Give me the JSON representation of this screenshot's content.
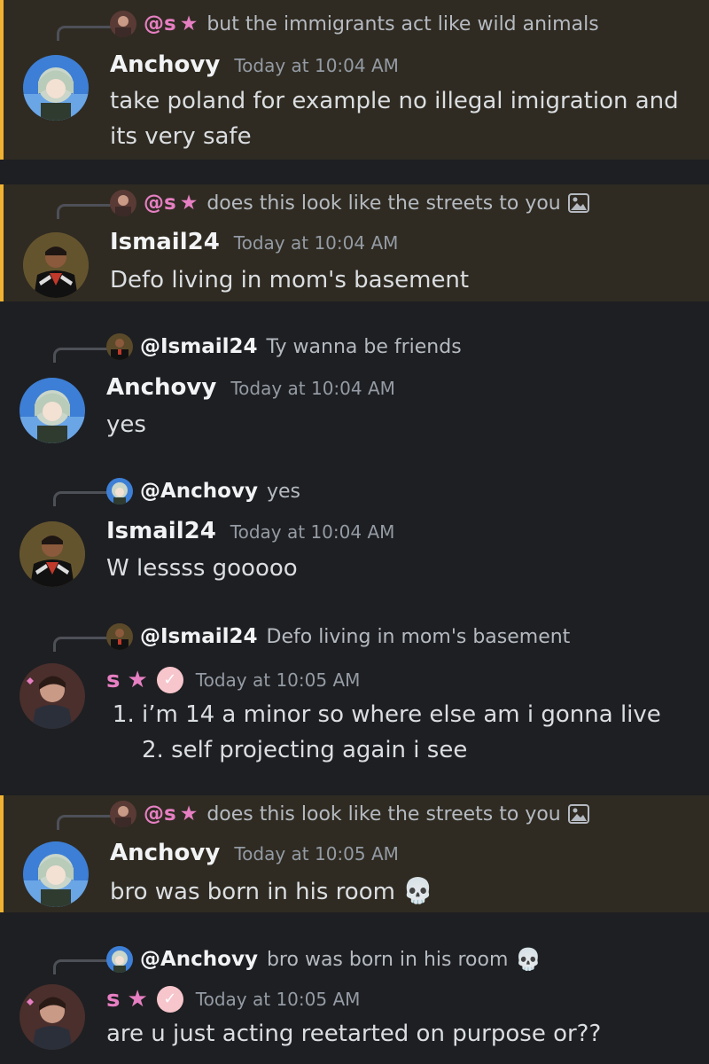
{
  "messages": [
    {
      "reply": {
        "name": "@s",
        "star": "★",
        "text": "but the immigrants act like wild animals"
      },
      "author": "Anchovy",
      "time": "Today at 10:04 AM",
      "content": "take poland for example no illegal imigration and its very safe"
    },
    {
      "reply": {
        "name": "@s",
        "star": "★",
        "text": "does this look like the streets to you"
      },
      "author": "Ismail24",
      "time": "Today at 10:04 AM",
      "content": "Defo living in mom's basement"
    },
    {
      "reply": {
        "name": "@Ismail24",
        "text": "Ty wanna be friends"
      },
      "author": "Anchovy",
      "time": "Today at 10:04 AM",
      "content": "yes"
    },
    {
      "reply": {
        "name": "@Anchovy",
        "text": "yes"
      },
      "author": "Ismail24",
      "time": "Today at 10:04 AM",
      "content": "W lessss gooooo"
    },
    {
      "reply": {
        "name": "@Ismail24",
        "text": "Defo living in mom's basement"
      },
      "author": "s",
      "star": "★",
      "time": "Today at 10:05 AM",
      "content_list": [
        "i’m 14 a minor so where else am i gonna live 2. self projecting again i see"
      ]
    },
    {
      "reply": {
        "name": "@s",
        "star": "★",
        "text": "does this look like the streets to you"
      },
      "author": "Anchovy",
      "time": "Today at 10:05 AM",
      "content": "bro was born in his room",
      "content_emoji": "💀"
    },
    {
      "reply": {
        "name": "@Anchovy",
        "text": "bro was born in his room",
        "emoji": "💀"
      },
      "author": "s",
      "star": "★",
      "time": "Today at 10:05 AM",
      "content": "are u just acting reetarted on purpose or??"
    }
  ],
  "colors": {
    "background": "#1e1f22",
    "highlight": "#2f2b22",
    "highlight_border": "#f0b232",
    "pink": "#e77fc3"
  }
}
